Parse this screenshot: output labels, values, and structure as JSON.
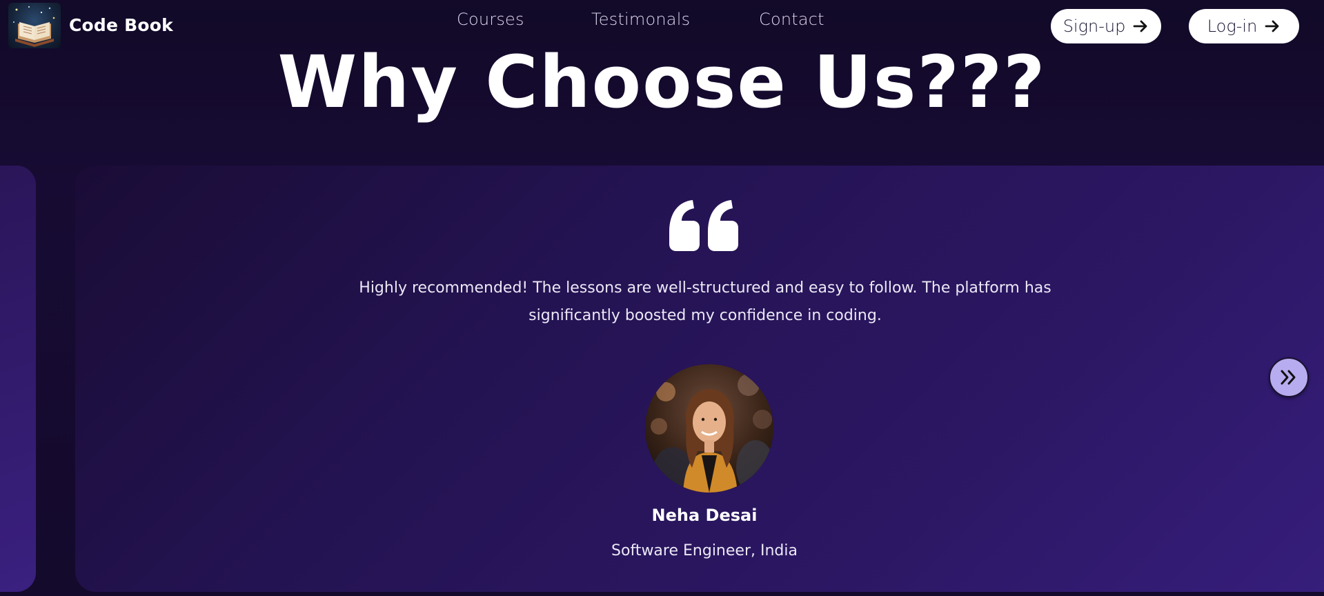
{
  "header": {
    "brand": "Code Book",
    "logo_icon": "open-book-icon",
    "nav": [
      {
        "label": "Courses"
      },
      {
        "label": "Testimonals"
      },
      {
        "label": "Contact"
      }
    ],
    "signup_label": "Sign-up",
    "login_label": "Log-in",
    "button_icon": "arrow-right-icon"
  },
  "hero": {
    "title": "Why Choose Us???"
  },
  "testimonial": {
    "quote_icon": "quote-icon",
    "text": "Highly recommended! The lessons are well-structured and easy to follow. The platform has significantly boosted my confidence in coding.",
    "name": "Neha Desai",
    "role": "Software Engineer, India",
    "next_icon": "double-chevron-right-icon"
  },
  "colors": {
    "background": "#140a2c",
    "card_start": "#1a0c36",
    "card_end": "#361e7c",
    "button_bg": "#ffffff",
    "next_button_bg": "#b8acf0"
  }
}
